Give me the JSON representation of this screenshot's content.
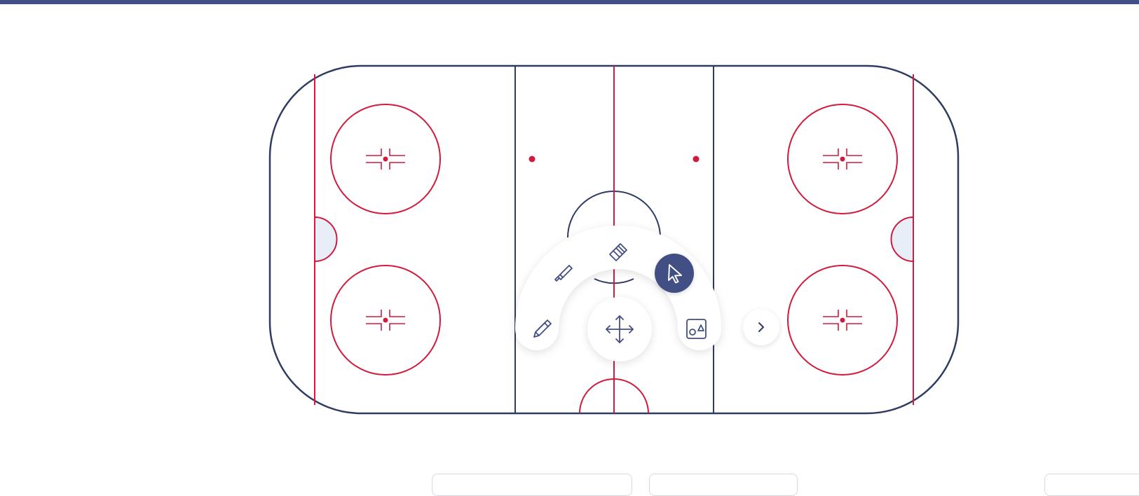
{
  "header": {
    "accent_color": "#424f84"
  },
  "rink": {
    "board_color": "#2e3b63",
    "line_color": "#d11a3d",
    "crease_fill": "#e8eef8",
    "elements": [
      "boards",
      "goal-line-left",
      "goal-line-right",
      "blue-line-left",
      "blue-line-right",
      "center-red-line",
      "center-circle",
      "referee-crease",
      "faceoff-circle-top-left",
      "faceoff-circle-bottom-left",
      "faceoff-circle-top-right",
      "faceoff-circle-bottom-right",
      "neutral-zone-dot-left",
      "neutral-zone-dot-right",
      "goal-crease-left",
      "goal-crease-right"
    ]
  },
  "radial_menu": {
    "selected_tool": "select",
    "tools": [
      {
        "id": "pen",
        "icon": "pencil-icon"
      },
      {
        "id": "marker",
        "icon": "marker-icon"
      },
      {
        "id": "eraser",
        "icon": "eraser-icon"
      },
      {
        "id": "select",
        "icon": "cursor-arrow-icon"
      },
      {
        "id": "shapes",
        "icon": "shapes-icon"
      },
      {
        "id": "move",
        "icon": "move-arrows-icon"
      }
    ],
    "next_icon": "chevron-right-icon",
    "selected_color": "#424f84",
    "icon_color": "#424f84"
  },
  "bottom_toolbar": {
    "buttons": [
      "",
      "",
      ""
    ]
  }
}
